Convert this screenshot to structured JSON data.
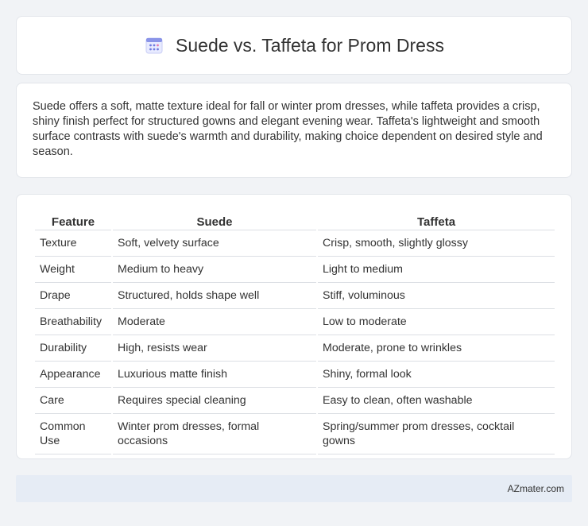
{
  "header": {
    "title": "Suede vs. Taffeta for Prom Dress",
    "icon": "calendar-icon"
  },
  "summary": {
    "text": "Suede offers a soft, matte texture ideal for fall or winter prom dresses, while taffeta provides a crisp, shiny finish perfect for structured gowns and elegant evening wear. Taffeta's lightweight and smooth surface contrasts with suede's warmth and durability, making choice dependent on desired style and season."
  },
  "table": {
    "headers": [
      "Feature",
      "Suede",
      "Taffeta"
    ],
    "rows": [
      [
        "Texture",
        "Soft, velvety surface",
        "Crisp, smooth, slightly glossy"
      ],
      [
        "Weight",
        "Medium to heavy",
        "Light to medium"
      ],
      [
        "Drape",
        "Structured, holds shape well",
        "Stiff, voluminous"
      ],
      [
        "Breathability",
        "Moderate",
        "Low to moderate"
      ],
      [
        "Durability",
        "High, resists wear",
        "Moderate, prone to wrinkles"
      ],
      [
        "Appearance",
        "Luxurious matte finish",
        "Shiny, formal look"
      ],
      [
        "Care",
        "Requires special cleaning",
        "Easy to clean, often washable"
      ],
      [
        "Common Use",
        "Winter prom dresses, formal occasions",
        "Spring/summer prom dresses, cocktail gowns"
      ]
    ]
  },
  "footer": {
    "text": "AZmater.com"
  }
}
